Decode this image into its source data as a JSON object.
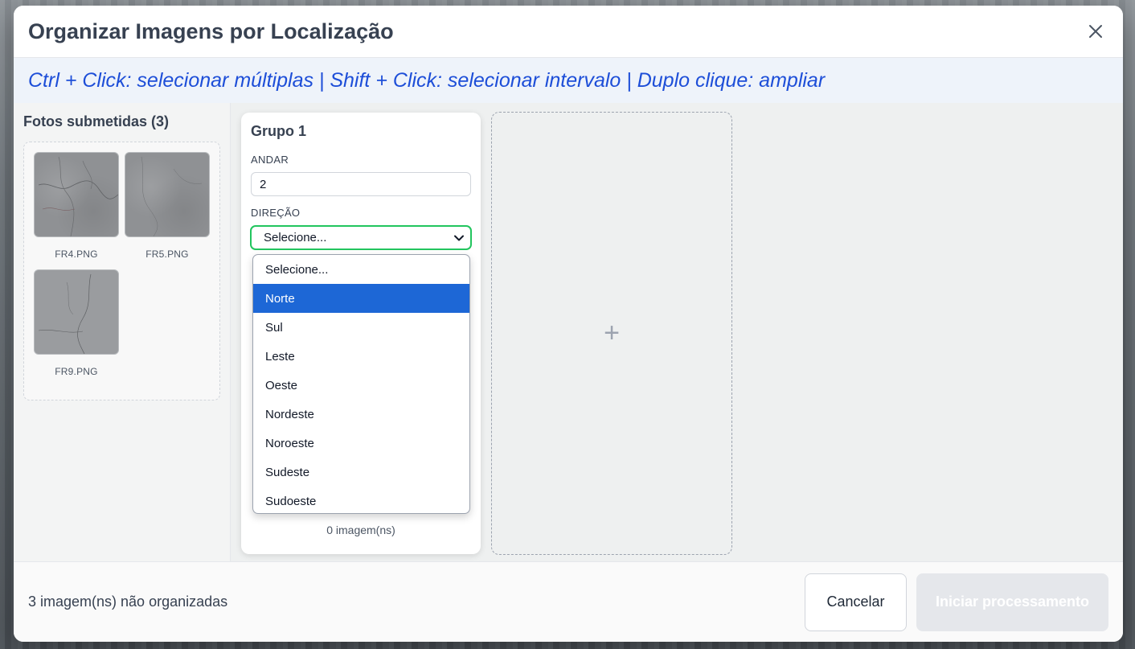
{
  "modal": {
    "title": "Organizar Imagens por Localização",
    "close_icon": "close-icon",
    "hint": "Ctrl + Click: selecionar múltiplas | Shift + Click: selecionar intervalo | Duplo clique: ampliar"
  },
  "left_panel": {
    "title": "Fotos submetidas (3)",
    "photos": [
      {
        "name": "FR4.PNG"
      },
      {
        "name": "FR5.PNG"
      },
      {
        "name": "FR9.PNG"
      }
    ]
  },
  "group": {
    "title": "Grupo 1",
    "floor_label": "ANDAR",
    "floor_value": "2",
    "direction_label": "DIREÇÃO",
    "direction_selected": "Selecione...",
    "direction_options": [
      "Selecione...",
      "Norte",
      "Sul",
      "Leste",
      "Oeste",
      "Nordeste",
      "Noroeste",
      "Sudeste",
      "Sudoeste"
    ],
    "highlighted_option": "Norte",
    "count": "0 imagem(ns)"
  },
  "add_group": {
    "icon": "plus-icon",
    "symbol": "+"
  },
  "footer": {
    "status": "3 imagem(ns) não organizadas",
    "cancel_label": "Cancelar",
    "start_label": "Iniciar processamento"
  },
  "colors": {
    "accent_blue": "#1d4ed8",
    "select_border": "#22c55e",
    "option_highlight": "#1d67d6"
  }
}
